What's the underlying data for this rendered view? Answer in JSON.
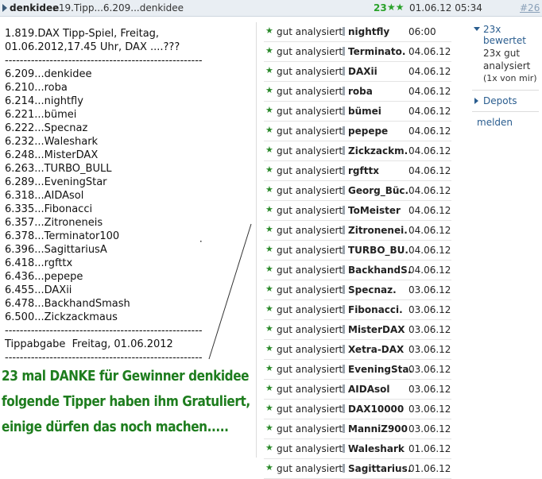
{
  "header": {
    "author": "denkidee",
    "subject": ": 19.Tipp...6.209...denkidee",
    "rating_count": "23",
    "rating_stars": "★★",
    "datetime": "01.06.12 05:34",
    "post_number": "#26"
  },
  "post": {
    "title": "1.819.DAX Tipp-Spiel, Freitag, 01.06.2012,17.45 Uhr, DAX ....???",
    "separator": "-----------------------------------------------------",
    "tips": [
      "6.209...denkidee",
      "6.210...roba",
      "6.214...nightfly",
      "6.221...bümei",
      "6.222...Specnaz",
      "6.232...Waleshark",
      "6.248...MisterDAX",
      "6.263...TURBO_BULL",
      "6.289...EveningStar",
      "6.318...AIDAsol",
      "6.335...Fibonacci",
      "6.357...Zitroneneis",
      "6.378...Terminator100",
      "6.396...SagittariusA",
      "6.418...rgfttx",
      "6.436...pepepe",
      "6.455...DAXii",
      "6.478...BackhandSmash",
      "6.500...Zickzackmaus"
    ],
    "footer": "Tippabgabe  Freitag, 01.06.2012"
  },
  "congrats": {
    "line1": "23 mal DANKE für Gewinner denkidee",
    "line2": "folgende Tipper haben ihm Gratuliert,",
    "line3": "einige dürfen das noch machen....."
  },
  "ratings": [
    {
      "label": "gut analysiert",
      "user": "nightfly",
      "when": "06:00"
    },
    {
      "label": "gut analysiert",
      "user": "Terminato.",
      "when": "04.06.12"
    },
    {
      "label": "gut analysiert",
      "user": "DAXii",
      "when": "04.06.12"
    },
    {
      "label": "gut analysiert",
      "user": "roba",
      "when": "04.06.12"
    },
    {
      "label": "gut analysiert",
      "user": "bümei",
      "when": "04.06.12"
    },
    {
      "label": "gut analysiert",
      "user": "pepepe",
      "when": "04.06.12"
    },
    {
      "label": "gut analysiert",
      "user": "Zickzackm.",
      "when": "04.06.12"
    },
    {
      "label": "gut analysiert",
      "user": "rgfttx",
      "when": "04.06.12"
    },
    {
      "label": "gut analysiert",
      "user": "Georg_Büc.",
      "when": "04.06.12"
    },
    {
      "label": "gut analysiert",
      "user": "ToMeister",
      "when": "04.06.12"
    },
    {
      "label": "gut analysiert",
      "user": "Zitronenei.",
      "when": "04.06.12"
    },
    {
      "label": "gut analysiert",
      "user": "TURBO_BU.",
      "when": "04.06.12"
    },
    {
      "label": "gut analysiert",
      "user": "BackhandS.",
      "when": "04.06.12"
    },
    {
      "label": "gut analysiert",
      "user": "Specnaz.",
      "when": "03.06.12"
    },
    {
      "label": "gut analysiert",
      "user": "Fibonacci.",
      "when": "03.06.12"
    },
    {
      "label": "gut analysiert",
      "user": "MisterDAX",
      "when": "03.06.12"
    },
    {
      "label": "gut analysiert",
      "user": "Xetra-DAX",
      "when": "03.06.12"
    },
    {
      "label": "gut analysiert",
      "user": "EveningSta.",
      "when": "03.06.12"
    },
    {
      "label": "gut analysiert",
      "user": "AIDAsol",
      "when": "03.06.12"
    },
    {
      "label": "gut analysiert",
      "user": "DAX10000",
      "when": "03.06.12"
    },
    {
      "label": "gut analysiert",
      "user": "ManniZ900",
      "when": "03.06.12"
    },
    {
      "label": "gut analysiert",
      "user": "Waleshark",
      "when": "01.06.12"
    },
    {
      "label": "gut analysiert",
      "user": "Sagittarius.",
      "when": "01.06.12"
    }
  ],
  "sidebar": {
    "rated_toggle": "23x bewertet",
    "rated_line1": "23x gut",
    "rated_line2": "analysiert",
    "rated_line3": "(1x von mir)",
    "depots": "Depots",
    "report": "melden"
  },
  "colors": {
    "header_bg": "#e9eef3",
    "accent_green": "#1e7d1e",
    "link_blue": "#2a5d8f"
  }
}
